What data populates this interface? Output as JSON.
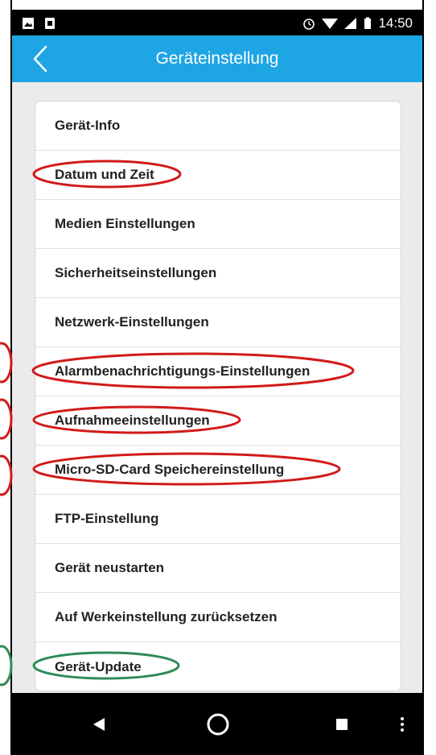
{
  "statusbar": {
    "time": "14:50"
  },
  "appbar": {
    "title": "Geräteinstellung"
  },
  "menu": {
    "items": [
      {
        "label": "Gerät-Info"
      },
      {
        "label": "Datum und Zeit"
      },
      {
        "label": "Medien Einstellungen"
      },
      {
        "label": "Sicherheitseinstellungen"
      },
      {
        "label": "Netzwerk-Einstellungen"
      },
      {
        "label": "Alarmbenachrichtigungs-Einstellungen"
      },
      {
        "label": "Aufnahmeeinstellungen"
      },
      {
        "label": "Micro-SD-Card Speichereinstellung"
      },
      {
        "label": "FTP-Einstellung"
      },
      {
        "label": "Gerät neustarten"
      },
      {
        "label": "Auf Werkeinstellung zurücksetzen"
      },
      {
        "label": "Gerät-Update"
      }
    ]
  },
  "colors": {
    "appbar": "#1ea5e3",
    "highlight_red": "#d11a1a",
    "highlight_green": "#2e8b57"
  }
}
